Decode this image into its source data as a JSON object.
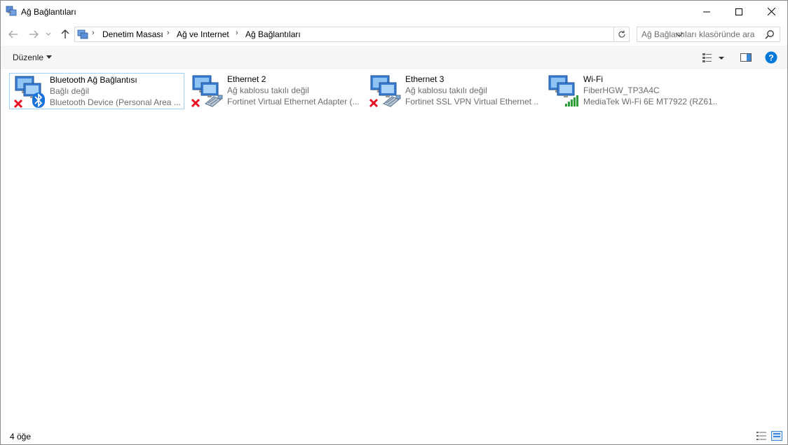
{
  "window": {
    "title": "Ağ Bağlantıları"
  },
  "address": {
    "crumbs": [
      "Denetim Masası",
      "Ağ ve Internet",
      "Ağ Bağlantıları"
    ]
  },
  "search": {
    "placeholder": "Ağ Bağlantıları klasöründe ara"
  },
  "toolbar": {
    "organize_label": "Düzenle"
  },
  "connections": [
    {
      "name": "Bluetooth Ağ Bağlantısı",
      "status": "Bağlı değil",
      "device": "Bluetooth Device (Personal Area ...",
      "type": "bluetooth",
      "disconnected": true
    },
    {
      "name": "Ethernet 2",
      "status": "Ağ kablosu takılı değil",
      "device": "Fortinet Virtual Ethernet Adapter (...",
      "type": "ethernet",
      "disconnected": true
    },
    {
      "name": "Ethernet 3",
      "status": "Ağ kablosu takılı değil",
      "device": "Fortinet SSL VPN Virtual Ethernet ...",
      "type": "ethernet",
      "disconnected": true
    },
    {
      "name": "Wi-Fi",
      "status": "FiberHGW_TP3A4C",
      "device": "MediaTek Wi-Fi 6E MT7922 (RZ61...",
      "type": "wifi",
      "disconnected": false
    }
  ],
  "status_bar": {
    "item_count": "4 öğe"
  },
  "colors": {
    "accent": "#0078d7",
    "selection_border": "#99d1ff",
    "error_red": "#e81123",
    "signal_green": "#2e9e3c"
  }
}
